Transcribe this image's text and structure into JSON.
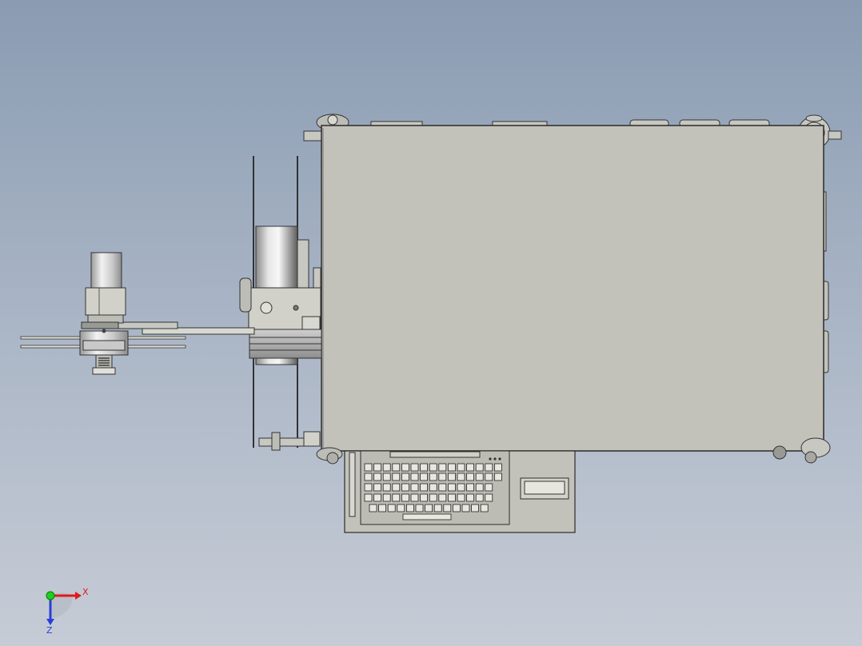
{
  "viewport": {
    "background_top": "#8a9cb2",
    "background_bottom": "#c6ccd6"
  },
  "model": {
    "body_color": "#c3c2ba",
    "outline_color": "#2b2b2b",
    "metal_color": "#d9d9d9"
  },
  "triad": {
    "x_label": "X",
    "z_label": "Z",
    "x_color": "#e01b1b",
    "y_color": "#1bd11b",
    "z_color": "#2a3fd6"
  }
}
